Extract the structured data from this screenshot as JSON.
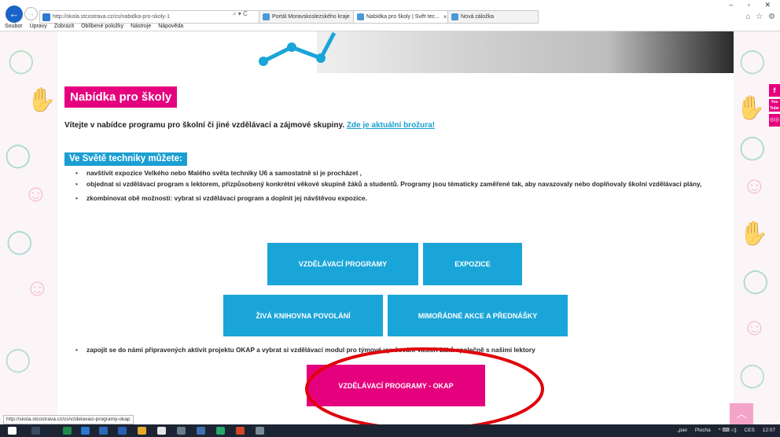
{
  "browser": {
    "url": "http://skola.stcostrava.cz/cs/nabidka-pro-skoly-1",
    "address_controls": "⌕ ▾ C",
    "tabs": [
      {
        "label": "Portál Moravskoslezského kraje",
        "active": false
      },
      {
        "label": "Nabídka pro školy | Svět tec...",
        "active": true
      },
      {
        "label": "Nová záložka",
        "active": false
      }
    ],
    "tab_close": "×",
    "menu": [
      "Soubor",
      "Úpravy",
      "Zobrazit",
      "Oblíbené položky",
      "Nástroje",
      "Nápověda"
    ],
    "window_controls": "– ▫ ✕",
    "toolbar_icons": "⌂ ☆ ⚙"
  },
  "page": {
    "title": "Nabídka pro školy",
    "intro_text": "Vítejte v nabídce programu pro školní či jiné vzdělávací a zájmové skupiny.",
    "intro_link": "Zde je aktuální brožura!",
    "section_title": "Ve Světě techniky můžete:",
    "bullets": [
      "navštívit expozice Velkého nebo Malého světa techniky U6 a samostatně si je procházet ,",
      "objednat si vzdělávací program s lektorem, přizpůsobený konkrétní věkové skupině žáků a studentů. Programy jsou tématicky zaměřené tak, aby navazovaly nebo doplňovaly školní vzdělávací plány,",
      "zkombinovat obě možnosti: vybrat si vzdělávací program a doplnit jej návštěvou expozice."
    ],
    "buttons": {
      "programs": "VZDĚLÁVACÍ PROGRAMY",
      "expozice": "EXPOZICE",
      "knihovna": "ŽIVÁ KNIHOVNA POVOLÁNÍ",
      "akce": "MIMOŘÁDNÉ AKCE A PŘEDNÁŠKY",
      "okap": "VZDĚLÁVACÍ PROGRAMY - OKAP"
    },
    "last_bullet": "zapojit se do námi připravených aktivit projektu OKAP a vybrat si vzdělávací modul pro týmové vyučování Vašich žáků společně s našimi lektory",
    "social": [
      "f",
      "You Tube",
      "◎◎"
    ],
    "scroll_top": "︿"
  },
  "status_url": "http://skola.stcostrava.cz/cs/vzdelavaci-programy-okap",
  "taskbar": {
    "tray_items": [
      "„pav",
      "Plocha",
      "^ ⌨ ◁)",
      "CES",
      "12:07"
    ]
  },
  "colors": {
    "brand_pink": "#e5007e",
    "brand_blue": "#1aa5d8",
    "annotation_red": "#e0000b"
  }
}
